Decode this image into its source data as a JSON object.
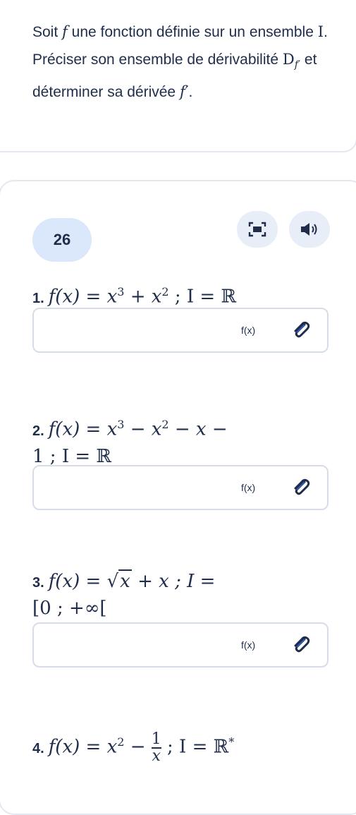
{
  "intro": {
    "p1": "Soit ",
    "f": "f",
    "p2": " une fonction définie sur un ensemble ",
    "I": "I",
    "p3": ". Préciser son ensemble de dérivabilité ",
    "D": "D",
    "Dsub": "f′",
    "p4": " et déterminer sa dérivée ",
    "fprime": "f′",
    "p5": "."
  },
  "exercise": {
    "number": "26"
  },
  "icons": {
    "expand": "expand-icon",
    "audio": "speaker-icon",
    "attach": "paperclip-icon"
  },
  "questions": [
    {
      "num": "1.",
      "pre": "f(x) = x",
      "sup1": "3",
      "mid1": " + x",
      "sup2": "2",
      "post": " ; I = ℝ",
      "answer_placeholder": "f(x)"
    },
    {
      "num": "2.",
      "pre": "f(x) = x",
      "sup1": "3",
      "mid1": " − x",
      "sup2": "2",
      "mid2": " − x −",
      "line2": "1 ; I = ℝ",
      "answer_placeholder": "f(x)"
    },
    {
      "num": "3.",
      "pre": "f(x) = ",
      "sqrt": "x",
      "mid1": " + x ; I =",
      "line2": "[0 ; +∞[",
      "answer_placeholder": "f(x)"
    },
    {
      "num": "4.",
      "pre": "f(x) = x",
      "sup1": "2",
      "mid1": " − ",
      "frac_num": "1",
      "frac_den": "x",
      "post": " ; I = ℝ",
      "sup2": "*"
    }
  ],
  "colors": {
    "text": "#1f2d4b",
    "badge": "#dbe8fb",
    "toolbtn": "#e8eef8",
    "border": "#d7dde8",
    "clip": "#2d66d6"
  }
}
